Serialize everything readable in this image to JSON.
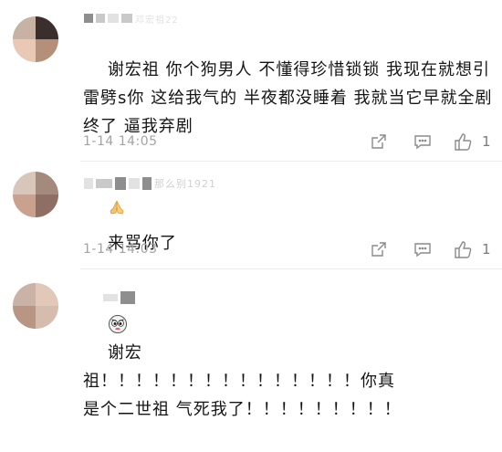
{
  "comments": [
    {
      "username": "邓宏祖22",
      "text": "谢宏祖 你个狗男人 不懂得珍惜锁锁 我现在就想引雷劈s你 这给我气的 半夜都没睡着 我就当它早就全剧终了 逼我弃剧",
      "emoji": "praying-hands-icon",
      "time": "1-14 14:05",
      "like_count": "1"
    },
    {
      "username": "那么别1921",
      "text": "来骂你了",
      "emoji": "angry-face-icon",
      "time": "1-14 14:03",
      "like_count": "1"
    },
    {
      "username": "",
      "text": "谢宏祖！！！！！！！！！！！！！！！你真是个二世祖 气死我了！！！！！！！！！",
      "emoji": "",
      "time": "",
      "like_count": ""
    }
  ],
  "colors": {
    "text": "#151515",
    "meta": "#a3a3a3",
    "icon": "#8a8a8a",
    "background": "#ffffff"
  }
}
